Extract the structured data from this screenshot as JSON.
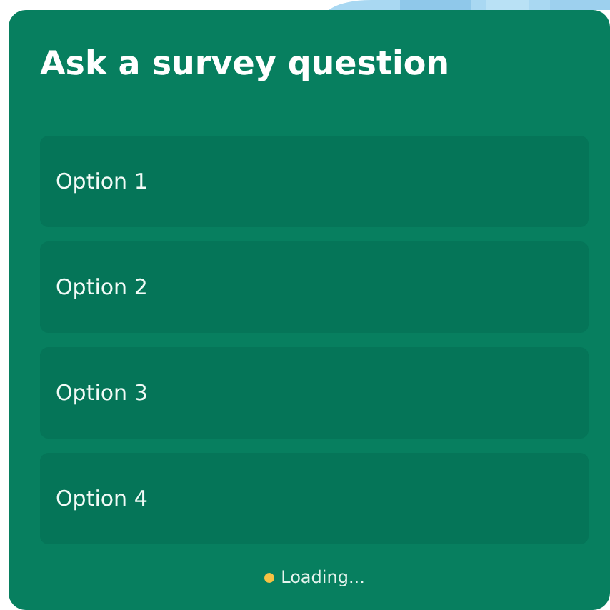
{
  "title": "Ask a survey question",
  "options": [
    {
      "label": "Option 1"
    },
    {
      "label": "Option 2"
    },
    {
      "label": "Option 3"
    },
    {
      "label": "Option 4"
    }
  ],
  "status": {
    "text": "Loading..."
  }
}
